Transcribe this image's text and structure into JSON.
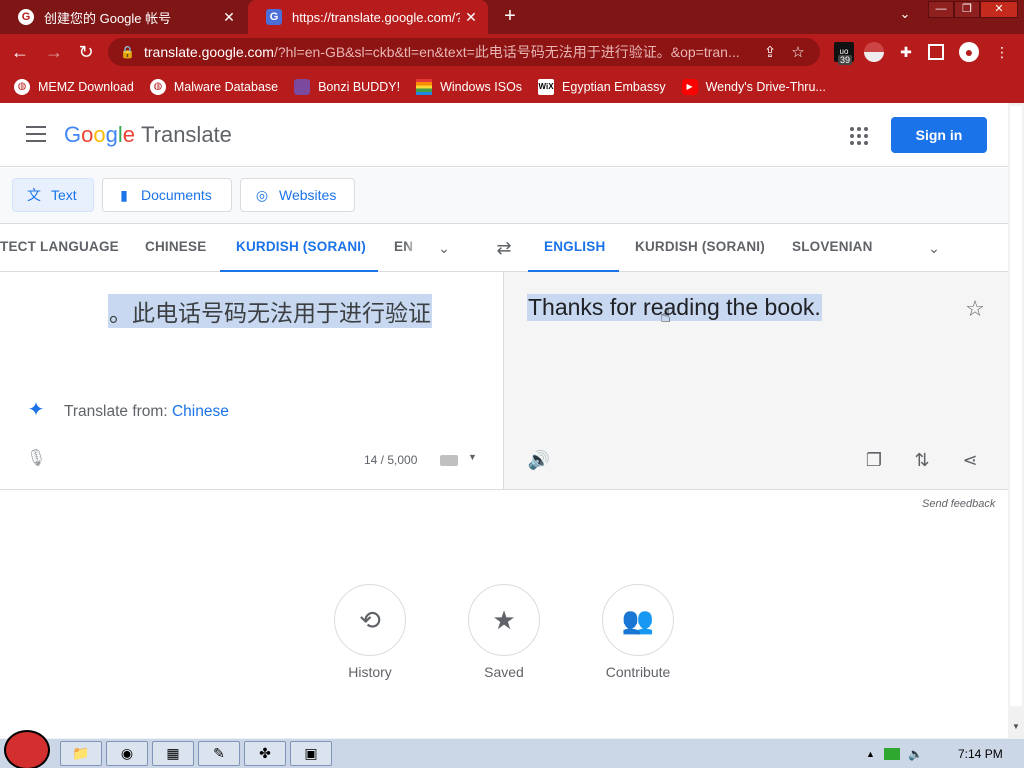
{
  "tabs": [
    {
      "title": "创建您的 Google 帐号",
      "favicon": "G",
      "close": "✕"
    },
    {
      "title": "https://translate.google.com/?hl=",
      "favicon": "G",
      "close": "✕"
    }
  ],
  "newtab_glyph": "+",
  "window_buttons": [
    "—",
    "❐",
    "✕"
  ],
  "omnibox": {
    "host": "translate.google.com",
    "path": "/?hl=en-GB&sl=ckb&tl=en&text=此电话号码无法用于进行验证。&op=tran..."
  },
  "extension_badge": "39",
  "bookmarks": [
    {
      "label": "MEMZ Download",
      "icon": "globe-icon"
    },
    {
      "label": "Malware Database",
      "icon": "globe-icon"
    },
    {
      "label": "Bonzi BUDDY!",
      "icon": "bonzi-icon"
    },
    {
      "label": "Windows ISOs",
      "icon": "rainbow-flag-icon"
    },
    {
      "label": "Egyptian Embassy",
      "icon": "wix-icon"
    },
    {
      "label": "Wendy's Drive-Thru...",
      "icon": "youtube-icon"
    }
  ],
  "header": {
    "logo_google": "Google",
    "logo_translate": "Translate",
    "signin": "Sign in"
  },
  "modes": [
    {
      "label": "Text",
      "active": true
    },
    {
      "label": "Documents",
      "active": false
    },
    {
      "label": "Websites",
      "active": false
    }
  ],
  "source_langs": [
    "TECT LANGUAGE",
    "CHINESE",
    "KURDISH (SORANI)",
    "EN"
  ],
  "target_langs": [
    "ENGLISH",
    "KURDISH (SORANI)",
    "SLOVENIAN"
  ],
  "source_text": "。此电话号码无法用于进行验证",
  "target_text": "Thanks for reading the book.",
  "translate_from": {
    "prefix": "Translate from: ",
    "lang": "Chinese"
  },
  "char_count": "14 / 5,000",
  "feedback": "Send feedback",
  "bottom_buttons": [
    {
      "label": "History",
      "icon": "history-icon"
    },
    {
      "label": "Saved",
      "icon": "star-icon"
    },
    {
      "label": "Contribute",
      "icon": "people-icon"
    }
  ],
  "clock": "7:14 PM",
  "colors": {
    "chrome": "#b71c1c",
    "accent": "#1a73e8",
    "selection": "#c8d8f0"
  }
}
